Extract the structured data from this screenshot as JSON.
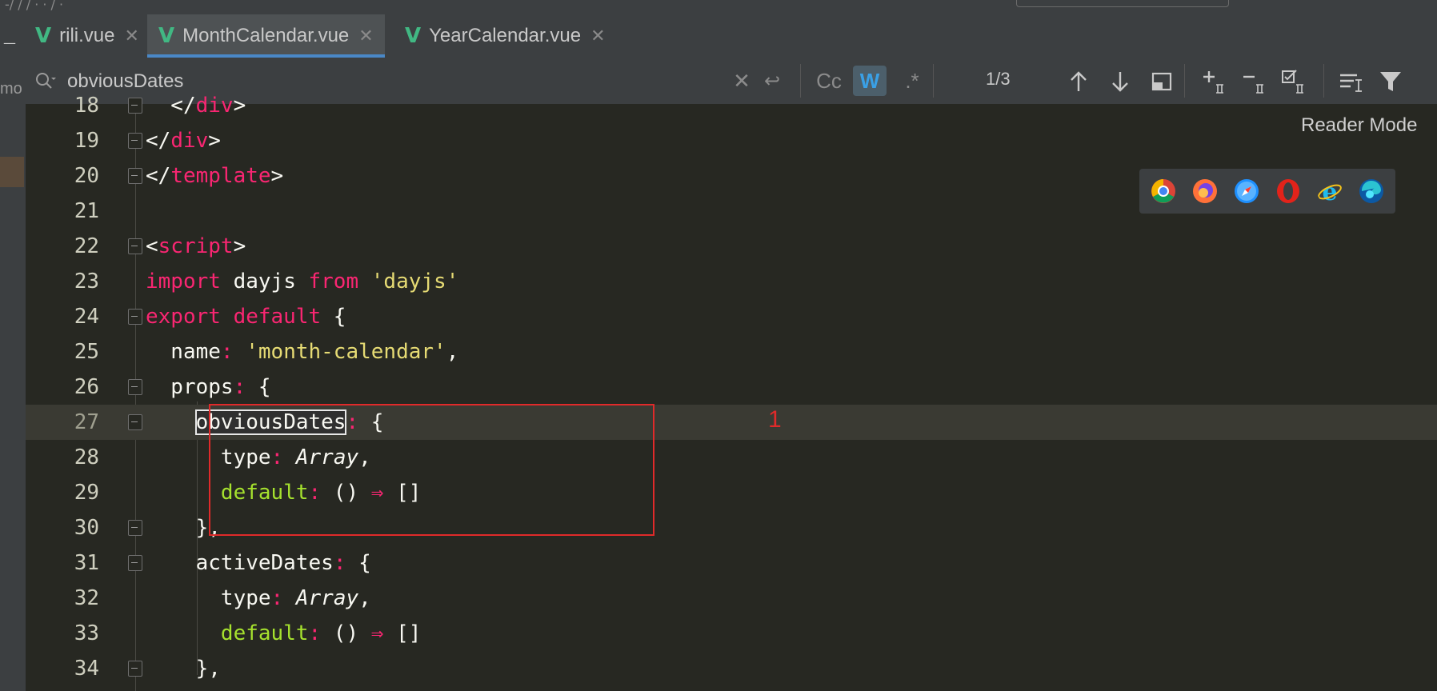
{
  "top_strip": {
    "breadcrumb": "-/              /                                   /  ·  ·  /  ·"
  },
  "left_edge": {
    "collapse_glyph": "—",
    "partial_label": "mo"
  },
  "tabs": [
    {
      "label": "rili.vue",
      "icon": "vue-icon",
      "active": false
    },
    {
      "label": "MonthCalendar.vue",
      "icon": "vue-icon",
      "active": true
    },
    {
      "label": "YearCalendar.vue",
      "icon": "vue-icon",
      "active": false
    }
  ],
  "find": {
    "value": "obviousDates",
    "placeholder": "",
    "match_case_label": "Cc",
    "words_label": "W",
    "regex_label": ".*",
    "count": "1/3"
  },
  "reader_mode_label": "Reader Mode",
  "annotation": {
    "label": "1",
    "color": "#e02a2a"
  },
  "editor": {
    "current_line": "27",
    "lines": [
      {
        "n": "18",
        "html": "  &lt;/<span class='tg'>div</span>&gt;"
      },
      {
        "n": "19",
        "html": "&lt;/<span class='tg'>div</span>&gt;"
      },
      {
        "n": "20",
        "html": "&lt;/<span class='tg'>template</span>&gt;"
      },
      {
        "n": "21",
        "html": ""
      },
      {
        "n": "22",
        "html": "&lt;<span class='tg'>script</span>&gt;"
      },
      {
        "n": "23",
        "html": "<span class='kw'>import</span> dayjs <span class='kw'>from</span> <span class='str'>'dayjs'</span>"
      },
      {
        "n": "24",
        "html": "<span class='kw'>export default</span> {"
      },
      {
        "n": "25",
        "html": "  name<span class='pn'>:</span> <span class='str'>'month-calendar'</span>,"
      },
      {
        "n": "26",
        "html": "  props<span class='pn'>:</span> {"
      },
      {
        "n": "27",
        "html": "    <span class='hl'>obviousDates</span><span class='pn'>:</span> {"
      },
      {
        "n": "28",
        "html": "      type<span class='pn'>:</span> <span class='ty'>Array</span>,"
      },
      {
        "n": "29",
        "html": "      <span class='fn'>default</span><span class='pn'>:</span> () <span class='kw'>⇒</span> []"
      },
      {
        "n": "30",
        "html": "    },"
      },
      {
        "n": "31",
        "html": "    activeDates<span class='pn'>:</span> {"
      },
      {
        "n": "32",
        "html": "      type<span class='pn'>:</span> <span class='ty'>Array</span>,"
      },
      {
        "n": "33",
        "html": "      <span class='fn'>default</span><span class='pn'>:</span> () <span class='kw'>⇒</span> []"
      },
      {
        "n": "34",
        "html": "    },"
      }
    ]
  },
  "colors": {
    "editor_bg": "#272822",
    "keyword": "#f92672",
    "string": "#e6db74",
    "function": "#a6e22e",
    "vue_green": "#41b883",
    "active_tab_underline": "#4a88c7"
  },
  "browser_icons": [
    "chrome-icon",
    "firefox-icon",
    "safari-icon",
    "opera-icon",
    "ie-icon",
    "edge-icon"
  ]
}
